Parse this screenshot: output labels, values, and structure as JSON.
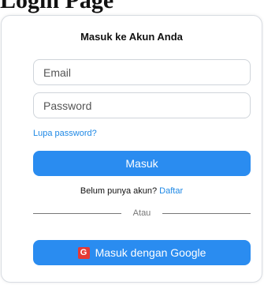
{
  "page": {
    "heading_fragment": "Login Page"
  },
  "card": {
    "title": "Masuk ke Akun Anda",
    "email": {
      "placeholder": "Email",
      "value": ""
    },
    "password": {
      "placeholder": "Password",
      "value": ""
    },
    "forgot_link": "Lupa password?",
    "login_button": "Masuk",
    "register_prompt": "Belum punya akun?",
    "register_link": "Daftar",
    "divider_text": "Atau",
    "google_icon_letter": "G",
    "google_button": "Masuk dengan Google"
  },
  "colors": {
    "primary": "#2a8cf0",
    "link": "#1e88e5",
    "google_icon": "#e53935"
  }
}
